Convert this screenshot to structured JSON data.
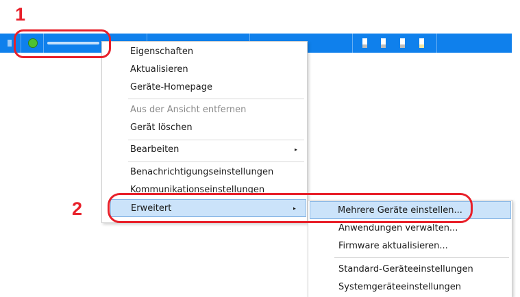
{
  "annotations": {
    "step1": "1",
    "step2": "2"
  },
  "colors": {
    "row_highlight": "#0f80ec",
    "status_ok": "#4ec230",
    "callout": "#e8202a",
    "menu_highlight": "#cbe3fa"
  },
  "icons": {
    "status": "green-status-dot-icon",
    "toner": "toner-level-icon",
    "submenu": "chevron-right-icon"
  },
  "context_menu": {
    "items": [
      {
        "label": "Eigenschaften"
      },
      {
        "label": "Aktualisieren"
      },
      {
        "label": "Geräte-Homepage"
      },
      {
        "label": "Aus der Ansicht entfernen"
      },
      {
        "label": "Gerät löschen"
      },
      {
        "label": "Bearbeiten"
      },
      {
        "label": "Benachrichtigungseinstellungen"
      },
      {
        "label": "Kommunikationseinstellungen"
      },
      {
        "label": "Erweitert"
      }
    ],
    "submenu_arrow": "▸"
  },
  "submenu": {
    "items": [
      {
        "label": "Mehrere Geräte einstellen..."
      },
      {
        "label": "Anwendungen verwalten..."
      },
      {
        "label": "Firmware aktualisieren..."
      },
      {
        "label": "Standard-Geräteeinstellungen"
      },
      {
        "label": "Systemgeräteeinstellungen"
      }
    ]
  }
}
